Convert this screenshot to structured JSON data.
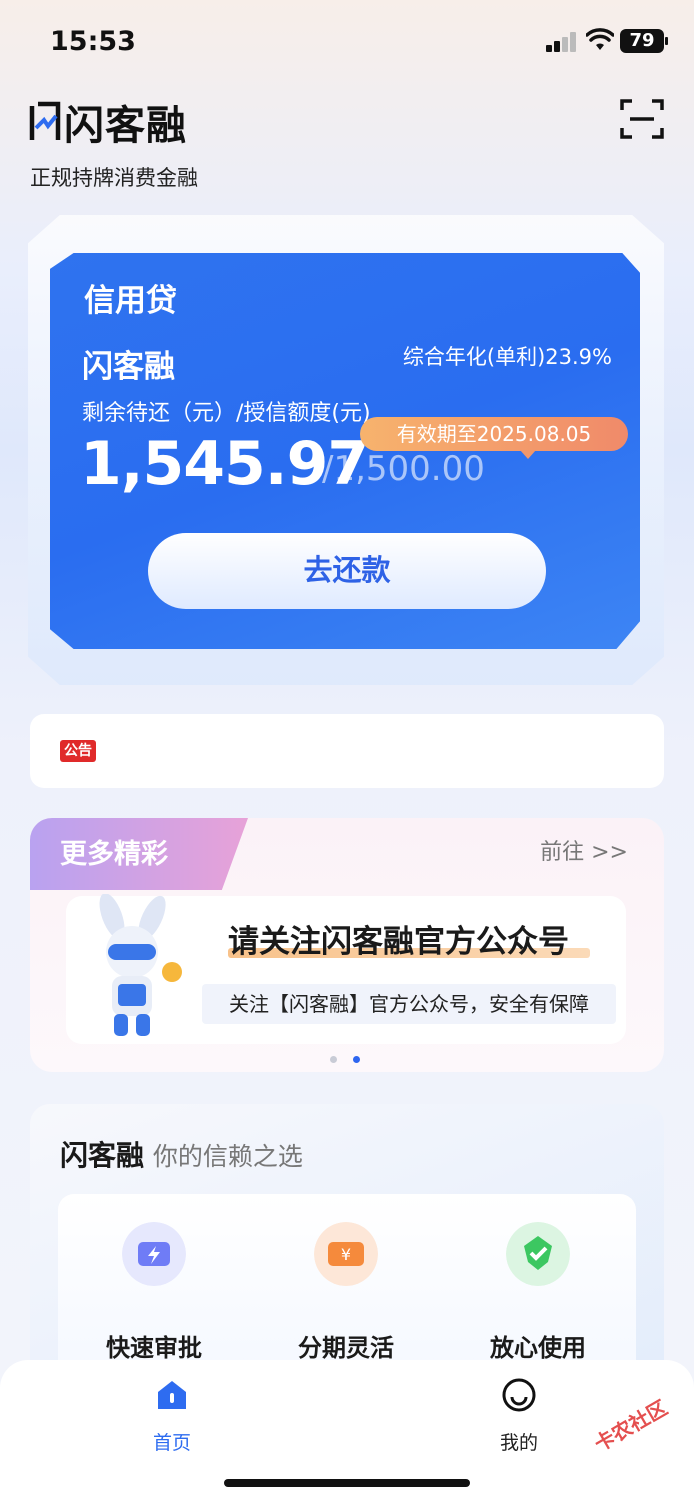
{
  "status": {
    "time": "15:53",
    "battery": "79"
  },
  "header": {
    "logo": "闪客融",
    "tagline": "正规持牌消费金融"
  },
  "credit_card": {
    "title": "信用贷",
    "brand": "闪客融",
    "rate": "综合年化(单利)23.9%",
    "subtitle": "剩余待还（元）/授信额度(元)",
    "expiry": "有效期至2025.08.05",
    "amount": "1,545.97",
    "limit": "/1,500.00",
    "repay_label": "去还款"
  },
  "notice": {
    "tag": "公告"
  },
  "more": {
    "title": "更多精彩",
    "link_label": "前往 >>",
    "banner_title": "请关注闪客融官方公众号",
    "banner_sub": "关注【闪客融】官方公众号，安全有保障"
  },
  "trust": {
    "brand": "闪客融",
    "slogan": "你的信赖之选",
    "features": [
      {
        "label": "快速审批",
        "icon": "lightning-icon",
        "color": "#6f7cf6"
      },
      {
        "label": "分期灵活",
        "icon": "yen-icon",
        "color": "#f58a3c"
      },
      {
        "label": "放心使用",
        "icon": "shield-check-icon",
        "color": "#3cc761"
      }
    ]
  },
  "tabbar": {
    "items": [
      {
        "label": "首页",
        "active": true
      },
      {
        "label": "我的",
        "active": false
      }
    ]
  },
  "watermark": "卡农社区",
  "colors": {
    "primary": "#2e6cf0",
    "accent": "#f08a6a",
    "notice_red": "#e02a2a"
  }
}
